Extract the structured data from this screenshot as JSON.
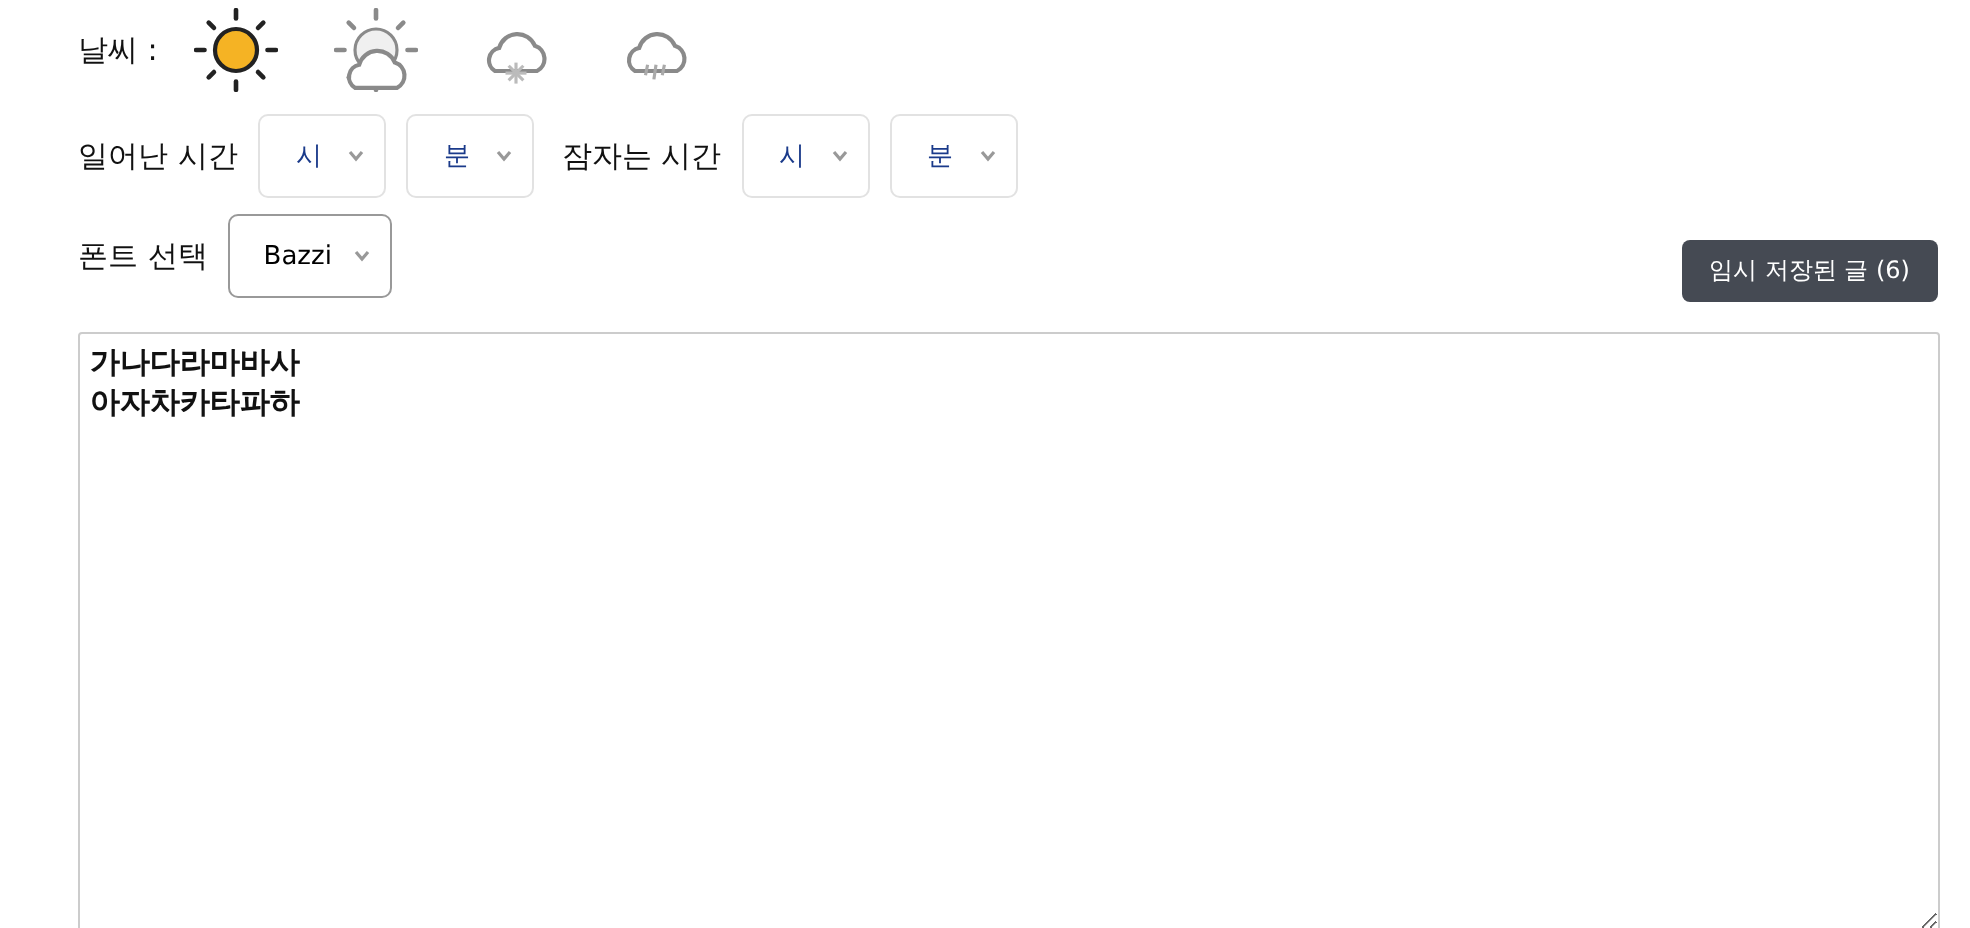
{
  "weather": {
    "label": "날씨 :",
    "options": [
      {
        "kind": "sun",
        "selected": true
      },
      {
        "kind": "partly-cloudy",
        "selected": false
      },
      {
        "kind": "snow",
        "selected": false
      },
      {
        "kind": "rain",
        "selected": false
      }
    ]
  },
  "wake_time": {
    "label": "일어난 시간",
    "hour": {
      "value": "시"
    },
    "minute": {
      "value": "분"
    }
  },
  "sleep_time": {
    "label": "잠자는 시간",
    "hour": {
      "value": "시"
    },
    "minute": {
      "value": "분"
    }
  },
  "font_select": {
    "label": "폰트 선택",
    "value": "Bazzi"
  },
  "drafts_button": {
    "label": "임시 저장된 글 (6)"
  },
  "editor": {
    "value": "가나다라마바사\n아자차카타파하"
  }
}
